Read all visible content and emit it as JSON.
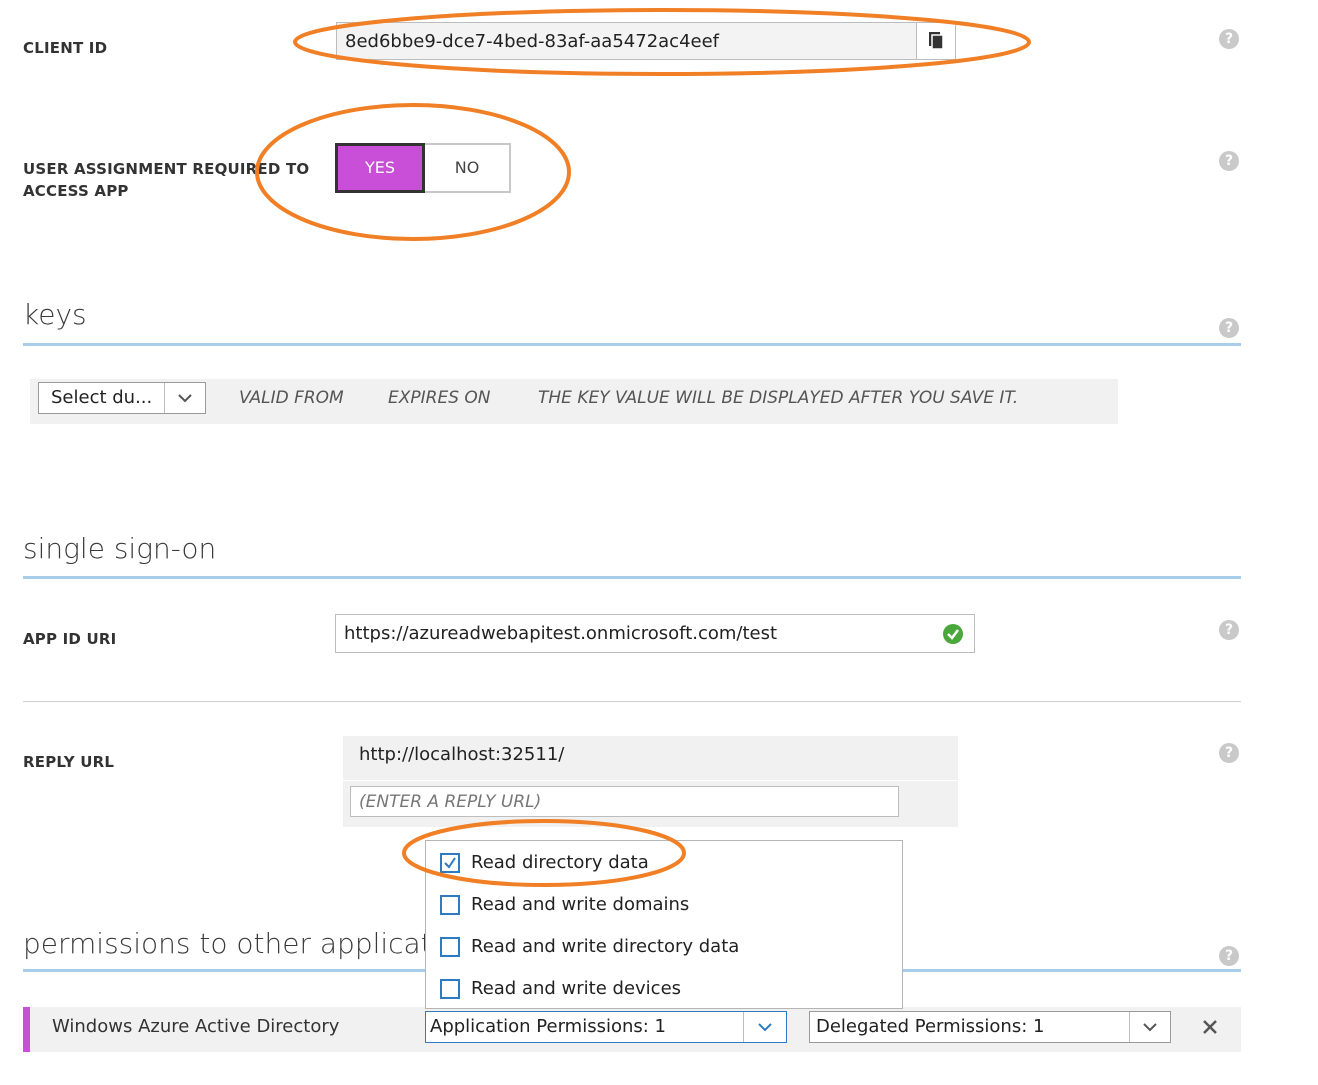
{
  "client_id": {
    "label": "CLIENT ID",
    "value": "8ed6bbe9-dce7-4bed-83af-aa5472ac4eef",
    "copy_icon": "copy-icon"
  },
  "user_assignment": {
    "label_line1": "USER ASSIGNMENT REQUIRED TO",
    "label_line2": "ACCESS APP",
    "yes_label": "YES",
    "no_label": "NO",
    "selected": "YES"
  },
  "keys": {
    "title": "keys",
    "duration_placeholder": "Select du...",
    "valid_from": "VALID FROM",
    "expires_on": "EXPIRES ON",
    "key_value_note": "THE KEY VALUE WILL BE DISPLAYED AFTER YOU SAVE IT."
  },
  "single_sign_on": {
    "title": "single sign-on",
    "app_id_uri_label": "APP ID URI",
    "app_id_uri_value": "https://azureadwebapitest.onmicrosoft.com/test",
    "reply_url_label": "REPLY URL",
    "reply_url_value": "http://localhost:32511/",
    "reply_url_placeholder": "(ENTER A REPLY URL)"
  },
  "permissions": {
    "title": "permissions to other applications",
    "dropdown_options": [
      {
        "label": "Read directory data",
        "checked": true
      },
      {
        "label": "Read and write domains",
        "checked": false
      },
      {
        "label": "Read and write directory data",
        "checked": false
      },
      {
        "label": "Read and write devices",
        "checked": false
      }
    ],
    "app_name": "Windows Azure Active Directory",
    "application_permissions": "Application Permissions: 1",
    "delegated_permissions": "Delegated Permissions: 1"
  },
  "help_symbol": "?",
  "colors": {
    "accent_purple": "#c94fd8",
    "highlight_orange": "#f07f25",
    "section_blue": "#a8cde8",
    "check_blue": "#2f7bbf",
    "valid_green": "#4aa83a"
  }
}
